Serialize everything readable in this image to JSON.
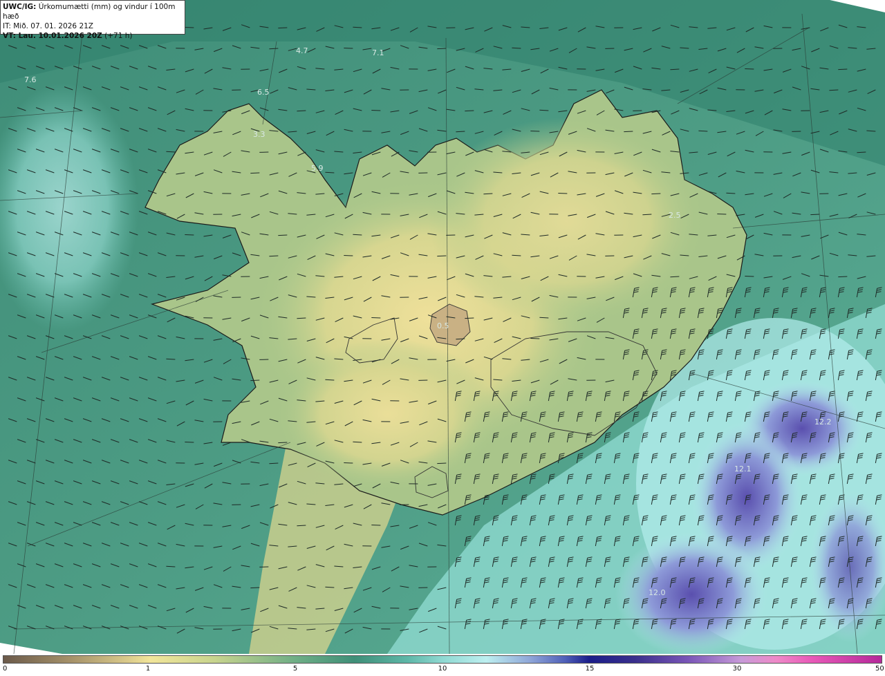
{
  "info": {
    "title_bold": "UWC/IG:",
    "title_rest": " Úrkomumætti (mm) og vindur í 100m hæð",
    "issue_time": "IT: Mið. 07. 01. 2026 21Z",
    "valid_label": "VT: Lau. 10.01.2026 20Z",
    "valid_offset": " (+71 h)"
  },
  "colorbar": {
    "ticks": [
      "0",
      "1",
      "5",
      "10",
      "15",
      "30",
      "50"
    ]
  },
  "stations": [
    {
      "id": "s1",
      "text": "4.7"
    },
    {
      "id": "s2",
      "text": "7.1"
    },
    {
      "id": "s3",
      "text": "7.6"
    },
    {
      "id": "s4",
      "text": "6.5"
    },
    {
      "id": "s5",
      "text": "3.3"
    },
    {
      "id": "s6",
      "text": "5.9"
    },
    {
      "id": "s7",
      "text": "2.5"
    },
    {
      "id": "s8",
      "text": "0.5"
    },
    {
      "id": "s9",
      "text": "12.2"
    },
    {
      "id": "s10",
      "text": "12.1"
    },
    {
      "id": "s11",
      "text": "12.0"
    }
  ],
  "colors": {
    "dry": "#e8dc8e",
    "moderate": "#4a9a80",
    "wet": "#9fe3de",
    "heavy": "#6a62b8"
  }
}
